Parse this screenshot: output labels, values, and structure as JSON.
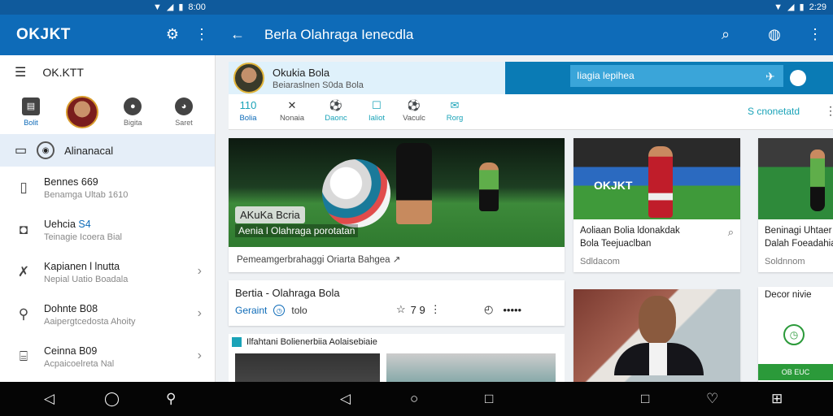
{
  "status": {
    "time": "2:29",
    "left_time": "8:00"
  },
  "appbar": {
    "brand": "OKJKT",
    "title": "Berla Olahraga Ienecdla",
    "back": "←",
    "search": "⌕",
    "more": "⋮"
  },
  "sidebar": {
    "header": "OK.KTT",
    "shortcuts": [
      {
        "label": "Bolit"
      },
      {
        "label": ""
      },
      {
        "label": "Bigita"
      },
      {
        "label": "Saret"
      }
    ],
    "selected": "Alinanacal",
    "items": [
      {
        "title": "Bennes 669",
        "subtitle": "Benamga Ultab 1610"
      },
      {
        "title": "Uehcia",
        "accent": "S4",
        "subtitle": "Teinagie Icoera Bial"
      },
      {
        "title": "Kapianen l lnutta",
        "subtitle": "Nepial Uatio Boadala"
      },
      {
        "title": "Dohnte B08",
        "subtitle": "Aaipergtcedosta Ahoity"
      },
      {
        "title": "Ceinna B09",
        "subtitle": "Acpaicoelreta Nal"
      }
    ]
  },
  "profile": {
    "name": "Okukia Bola",
    "subtitle": "Beiaraslnen S0da Bola"
  },
  "promo": {
    "search_text": "Iiagia lepihea"
  },
  "tabs": [
    {
      "icon": "110",
      "label": "Bolia"
    },
    {
      "icon": "✕",
      "label": "Nonaia"
    },
    {
      "icon": "⚽",
      "label": "Daonc"
    },
    {
      "icon": "☐",
      "label": "Ialiot"
    },
    {
      "icon": "⚽",
      "label": "Vaculc"
    },
    {
      "icon": "✉",
      "label": "Rorg"
    }
  ],
  "tabs_right": "S cnonetatd",
  "hero": {
    "tag": "AKuKa Bcria",
    "subtitle": "Aenia l Olahraga porotatan",
    "caption": "Pemeamgerbrahaggi Oriarta Bahgea ↗"
  },
  "card_red": {
    "title1": "Aoliaan Bolia ldonakdak",
    "title2": "Bola Teejuaclban",
    "meta": "Sdldacom",
    "banner": "OKJKT"
  },
  "card_green": {
    "title1": "Beninagi Uhtaer",
    "title2": "Dalah Foeadahia",
    "meta": "Soldnnom"
  },
  "article": {
    "title": "Bertia - Olahraga Bola",
    "meta_label": "Geraint",
    "meta_value": "tolo",
    "likes": "7 9"
  },
  "section_header": "Ilfahtani Bolienerbiia Aolaisebiaie",
  "side_card": {
    "title": "Decor nivie",
    "badge": "◷",
    "bar": "OB EUC"
  }
}
